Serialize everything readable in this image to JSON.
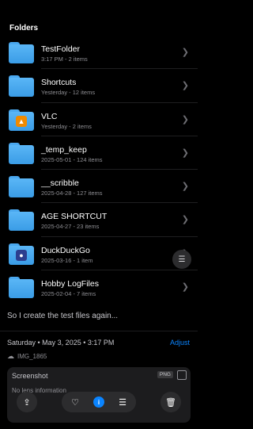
{
  "header": {
    "title": "Folders"
  },
  "folders": [
    {
      "name": "TestFolder",
      "meta": "3:17 PM - 2 items"
    },
    {
      "name": "Shortcuts",
      "meta": "Yesterday - 12 items"
    },
    {
      "name": "VLC",
      "meta": "Yesterday - 2 items",
      "badge": "vlc-cone-icon"
    },
    {
      "name": "_temp_keep",
      "meta": "2025-05-01 - 124 items"
    },
    {
      "name": "__scribble",
      "meta": "2025-04-28 - 127 items"
    },
    {
      "name": "AGE SHORTCUT",
      "meta": "2025-04-27 - 23 items"
    },
    {
      "name": "DuckDuckGo",
      "meta": "2025-03-16 - 1 item",
      "badge": "duckduckgo-icon"
    },
    {
      "name": "Hobby LogFiles",
      "meta": "2025-02-04 - 7 items"
    }
  ],
  "photo_info": {
    "caption": "So I create the test files again...",
    "datetime": "Saturday • May 3, 2025 • 3:17 PM",
    "adjust_label": "Adjust",
    "filename": "IMG_1865",
    "card_title": "Screenshot",
    "format_tag": "PNG",
    "lens_text": "No lens information"
  },
  "colors": {
    "accent": "#0a84ff",
    "folder": "#4aa8ef"
  }
}
